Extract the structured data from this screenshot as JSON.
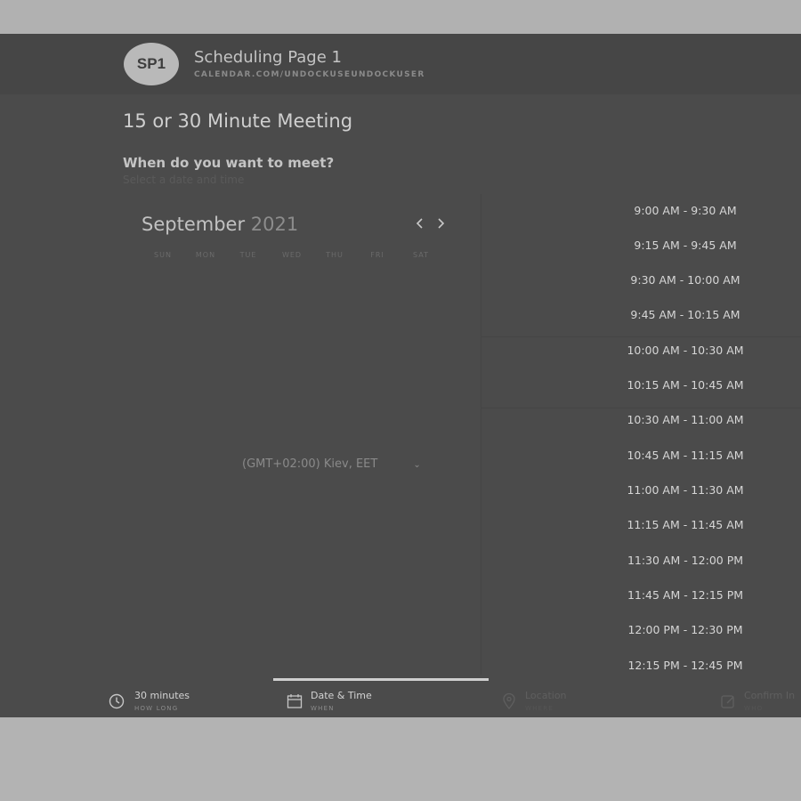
{
  "header": {
    "avatar_initials": "SP1",
    "page_name": "Scheduling Page 1",
    "page_url": "CALENDAR.COM/UNDOCKUSEUNDOCKUSER"
  },
  "meeting": {
    "title": "15 or 30 Minute Meeting",
    "question": "When do you want to meet?",
    "subtitle": "Select a date and time"
  },
  "calendar": {
    "month": "September",
    "year": "2021",
    "prev_icon": "chevron-left-icon",
    "next_icon": "chevron-right-icon",
    "weekdays": [
      "SUN",
      "MON",
      "TUE",
      "WED",
      "THU",
      "FRI",
      "SAT"
    ]
  },
  "timezone": {
    "label": "(GMT+02:00) Kiev, EET"
  },
  "time_slots": [
    "9:00 AM - 9:30 AM",
    "9:15 AM - 9:45 AM",
    "9:30 AM - 10:00 AM",
    "9:45 AM - 10:15 AM",
    "10:00 AM - 10:30 AM",
    "10:15 AM - 10:45 AM",
    "10:30 AM - 11:00 AM",
    "10:45 AM - 11:15 AM",
    "11:00 AM - 11:30 AM",
    "11:15 AM - 11:45 AM",
    "11:30 AM - 12:00 PM",
    "11:45 AM - 12:15 PM",
    "12:00 PM - 12:30 PM",
    "12:15 PM - 12:45 PM"
  ],
  "footer_tabs": [
    {
      "label": "30 minutes",
      "sub": "HOW LONG",
      "icon": "clock-icon"
    },
    {
      "label": "Date & Time",
      "sub": "WHEN",
      "icon": "calendar-icon"
    },
    {
      "label": "Location",
      "sub": "WHERE",
      "icon": "location-pin-icon"
    },
    {
      "label": "Confirm In",
      "sub": "WHO",
      "icon": "edit-icon"
    }
  ],
  "colors": {
    "backdrop": "#b1b1b1",
    "app_background": "#4b4b4b",
    "header_background": "#464646",
    "avatar_background": "#b9b9b9",
    "active_indicator": "#cfcfcf"
  }
}
